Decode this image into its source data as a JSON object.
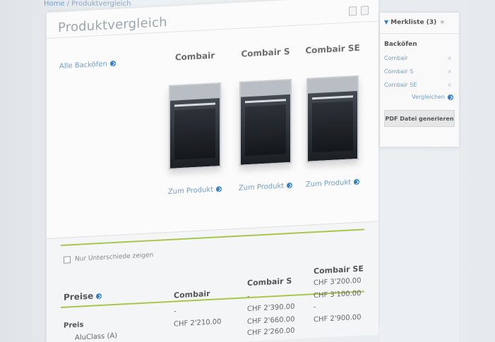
{
  "breadcrumb": {
    "home": "Home",
    "separator": " / ",
    "current": "Produktvergleich"
  },
  "main": {
    "title": "Produktvergleich",
    "all_link": "Alle Backöfen",
    "products": [
      {
        "name": "Combair",
        "link": "Zum Produkt"
      },
      {
        "name": "Combair S",
        "link": "Zum Produkt"
      },
      {
        "name": "Combair SE",
        "link": "Zum Produkt"
      }
    ],
    "only_diff_label": "Nur Unterschiede zeigen",
    "section_label": "Preise",
    "table": {
      "columns": [
        "Combair",
        "Combair S",
        "Combair SE"
      ],
      "rows": [
        {
          "label": "Preis",
          "values": [
            "-",
            "-",
            "CHF 3'200.00"
          ]
        },
        {
          "label": "",
          "values": [
            "",
            "CHF 2'390.00",
            "CHF 3'100.00"
          ]
        },
        {
          "label": "AluClass (A)",
          "values": [
            "CHF 2'210.00",
            "CHF 2'660.00",
            "-"
          ]
        },
        {
          "label": "",
          "values": [
            "",
            "CHF 2'260.00",
            "CHF 2'900.00"
          ]
        }
      ]
    }
  },
  "sidebar": {
    "title": "Merkliste (3)",
    "section": "Backöfen",
    "items": [
      "Combair",
      "Combair S",
      "Combair SE"
    ],
    "compare_link": "Vergleichen",
    "pdf_button": "PDF Datei generieren"
  }
}
